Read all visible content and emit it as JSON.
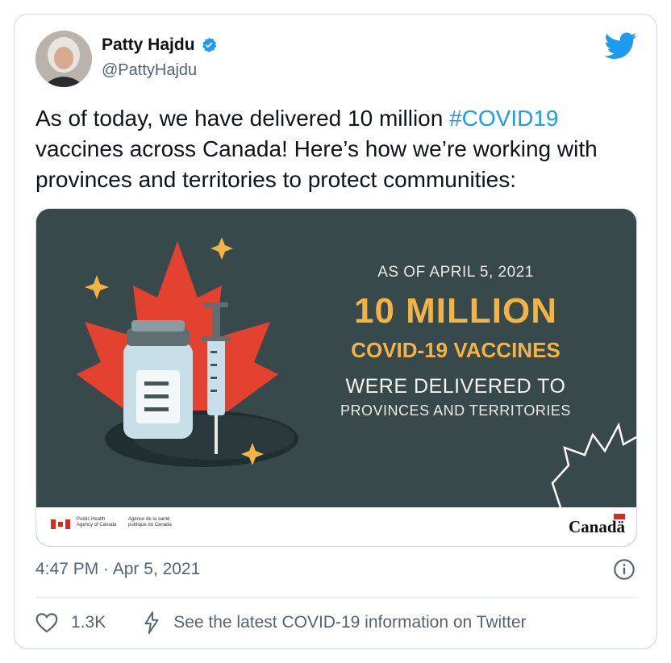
{
  "author": {
    "name": "Patty Hajdu",
    "handle": "@PattyHajdu",
    "verified_icon": "verified-badge-icon"
  },
  "tweet": {
    "text_before": "As of today, we have delivered 10 million ",
    "hashtag": "#COVID19",
    "text_after": " vaccines across Canada! Here’s how we’re working with provinces and territories to protect communities:"
  },
  "media": {
    "as_of": "AS OF APRIL 5, 2021",
    "headline": "10 MILLION",
    "subheadline": "COVID-19 VACCINES",
    "line1": "WERE DELIVERED TO",
    "line2": "PROVINCES AND TERRITORIES",
    "agency_en": "Public Health Agency of Canada",
    "agency_fr": "Agence de la santé publique du Canada",
    "wordmark": "Canadä"
  },
  "meta": {
    "timestamp": "4:47 PM · Apr 5, 2021"
  },
  "actions": {
    "like_count": "1.3K",
    "covid_link": "See the latest COVID-19 information on Twitter"
  },
  "colors": {
    "accent": "#1d9bf0",
    "infographic_bg": "#37494b",
    "infographic_gold": "#f3b445",
    "maple_red": "#e2422f"
  }
}
